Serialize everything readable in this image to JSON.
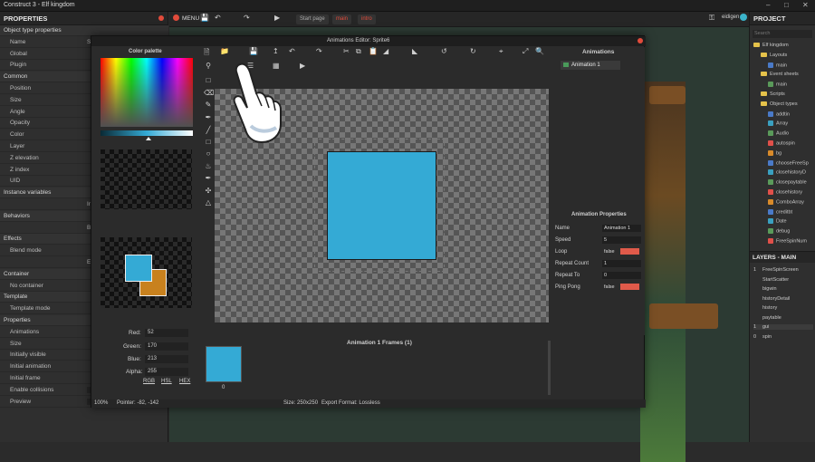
{
  "app": {
    "title": "Construct 3 - Elf kingdom",
    "user": "eidigen"
  },
  "properties": {
    "title": "PROPERTIES",
    "rows": [
      {
        "k": "Object type properties",
        "sec": true
      },
      {
        "k": "Name",
        "v": "S"
      },
      {
        "k": "Global",
        "v": ""
      },
      {
        "k": "Plugin",
        "v": ""
      },
      {
        "k": "Common",
        "sec": true
      },
      {
        "k": "Position",
        "v": ""
      },
      {
        "k": "Size",
        "v": ""
      },
      {
        "k": "Angle",
        "v": ""
      },
      {
        "k": "Opacity",
        "v": ""
      },
      {
        "k": "Color",
        "v": ""
      },
      {
        "k": "Layer",
        "v": ""
      },
      {
        "k": "Z elevation",
        "v": ""
      },
      {
        "k": "Z index",
        "v": ""
      },
      {
        "k": "UID",
        "v": ""
      },
      {
        "k": "Instance variables",
        "sec": true
      },
      {
        "k": "",
        "v": "Instance var"
      },
      {
        "k": "Behaviors",
        "sec": true
      },
      {
        "k": "",
        "v": "Behavio"
      },
      {
        "k": "Effects",
        "sec": true
      },
      {
        "k": "Blend mode",
        "v": ""
      },
      {
        "k": "",
        "v": "Effect"
      },
      {
        "k": "Container",
        "sec": true
      },
      {
        "k": "No container",
        "v": ""
      },
      {
        "k": "Template",
        "sec": true
      },
      {
        "k": "Template mode",
        "v": ""
      },
      {
        "k": "Properties",
        "sec": true
      },
      {
        "k": "Animations",
        "v": ""
      },
      {
        "k": "Size",
        "v": ""
      },
      {
        "k": "Initially visible",
        "v": ""
      },
      {
        "k": "Initial animation",
        "v": ""
      },
      {
        "k": "Initial frame",
        "v": ""
      },
      {
        "k": "Enable collisions",
        "v": "true"
      },
      {
        "k": "Preview",
        "v": "Disabled"
      }
    ]
  },
  "toolbar": {
    "menu": "MENU",
    "tabs": [
      "Start page",
      "main",
      "intro"
    ]
  },
  "project": {
    "title": "PROJECT",
    "search_placeholder": "Search",
    "tree": [
      "Elf kingdom",
      "Layouts",
      "main",
      "Event sheets",
      "main",
      "Scripts",
      "Object types",
      "addtin",
      "Array",
      "Audio",
      "autospin",
      "bg",
      "chooseFreeSp",
      "closehistoryD",
      "closepaytable",
      "closehistory",
      "ComboArray",
      "creditbt",
      "Date",
      "debug",
      "FreeSpinNum"
    ],
    "layers_title": "LAYERS - MAIN",
    "layers": [
      {
        "n": "1",
        "name": "FreeSpinScreen"
      },
      {
        "n": "",
        "name": "StartScatter"
      },
      {
        "n": "",
        "name": "bigwin"
      },
      {
        "n": "",
        "name": "historyDetail"
      },
      {
        "n": "",
        "name": "history"
      },
      {
        "n": "",
        "name": "paytable"
      },
      {
        "n": "1",
        "name": "gui"
      },
      {
        "n": "0",
        "name": "spin"
      }
    ]
  },
  "editor": {
    "title": "Animations Editor: Sprite6",
    "palette_title": "Color palette",
    "red_label": "Red:",
    "red": "52",
    "green_label": "Green:",
    "green": "170",
    "blue_label": "Blue:",
    "blue": "213",
    "alpha_label": "Alpha:",
    "alpha": "255",
    "modes": [
      "RGB",
      "HSL",
      "HEX"
    ],
    "primary_color": "#34aad5",
    "secondary_color": "#c8811e",
    "animations_title": "Animations",
    "animation_item": "Animation 1",
    "anim_props_title": "Animation Properties",
    "props": [
      {
        "k": "Name",
        "v": "Animation 1"
      },
      {
        "k": "Speed",
        "v": "5"
      },
      {
        "k": "Loop",
        "v": "false"
      },
      {
        "k": "Repeat Count",
        "v": "1"
      },
      {
        "k": "Repeat To",
        "v": "0"
      },
      {
        "k": "Ping Pong",
        "v": "false"
      }
    ],
    "frames_title": "Animation 1 Frames (1)",
    "frame_index": "0",
    "zoom": "100%",
    "pointer": "Pointer: -82, -142",
    "size": "Size: 250x250",
    "export": "Export Format: Lossless"
  }
}
